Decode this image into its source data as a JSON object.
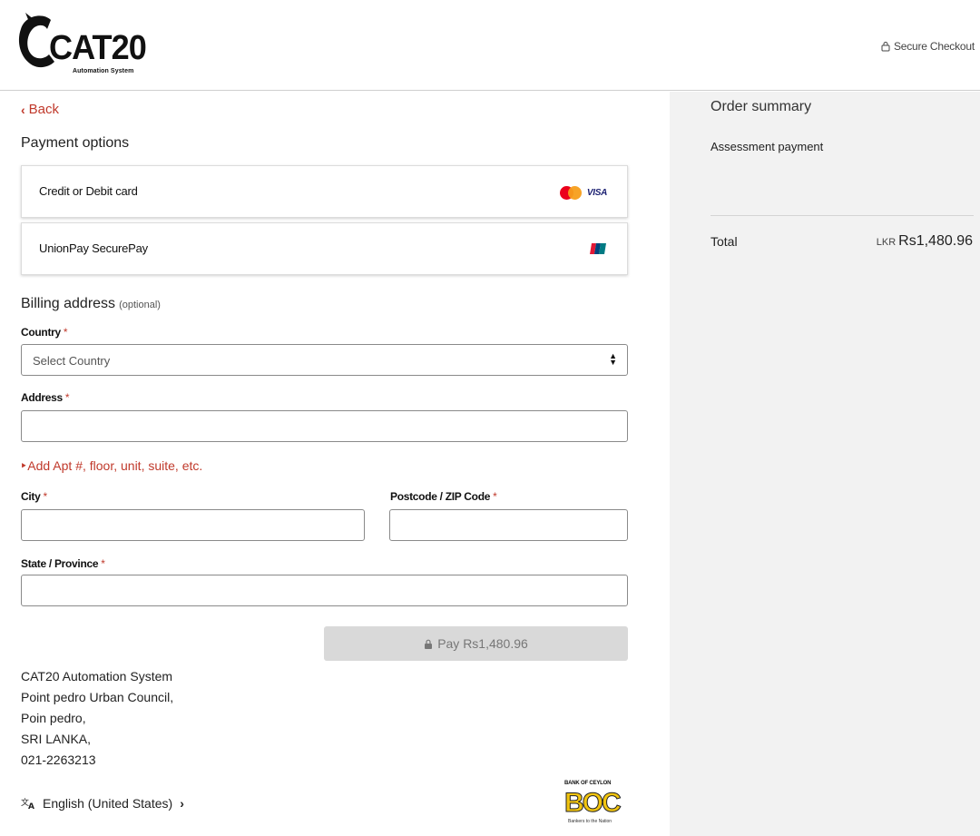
{
  "header": {
    "logo_text": "CAT20",
    "logo_subtitle": "Automation System",
    "secure_checkout": "Secure Checkout"
  },
  "nav": {
    "back_label": "Back"
  },
  "payment": {
    "section_title": "Payment options",
    "options": [
      {
        "label": "Credit or Debit card",
        "icons": [
          "mastercard-icon",
          "visa-icon"
        ],
        "brand_text": "VISA"
      },
      {
        "label": "UnionPay SecurePay",
        "icons": [
          "unionpay-icon"
        ]
      }
    ]
  },
  "billing": {
    "title": "Billing address",
    "optional": "(optional)",
    "country": {
      "label": "Country",
      "required": "*",
      "value": "Select Country"
    },
    "address": {
      "label": "Address",
      "required": "*",
      "value": ""
    },
    "add_apt": "Add Apt #, floor, unit, suite, etc.",
    "city": {
      "label": "City",
      "required": "*",
      "value": ""
    },
    "postcode": {
      "label": "Postcode / ZIP Code",
      "required": "*",
      "value": ""
    },
    "state": {
      "label": "State / Province",
      "required": "*",
      "value": ""
    }
  },
  "pay_button": {
    "label": "Pay Rs1,480.96"
  },
  "merchant": {
    "lines": [
      "CAT20 Automation System",
      "Point pedro Urban Council,",
      "Poin pedro,",
      "SRI LANKA,",
      "021-2263213"
    ]
  },
  "language": {
    "label": "English (United States)"
  },
  "bank_logo": {
    "top": "BANK OF CEYLON",
    "mark": "BOC",
    "tagline": "Bankers to the Nation"
  },
  "summary": {
    "title": "Order summary",
    "item": "Assessment payment",
    "total_label": "Total",
    "currency": "LKR",
    "total_value": "Rs1,480.96"
  },
  "colors": {
    "accent": "#c0392b",
    "panel_bg": "#f2f2f2",
    "button_disabled": "#d9d9d9"
  }
}
